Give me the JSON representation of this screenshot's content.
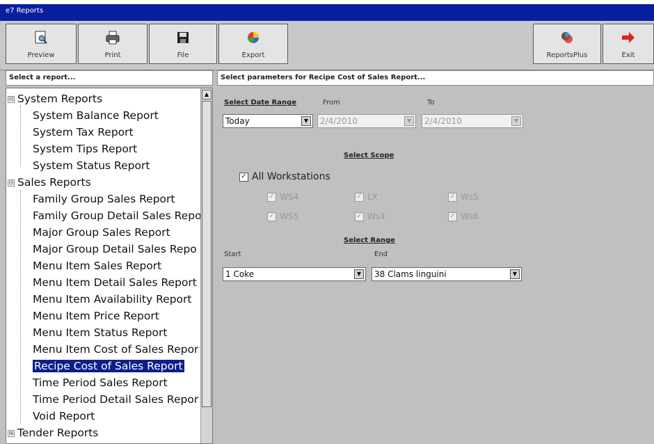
{
  "window": {
    "title": "e7 Reports"
  },
  "toolbar": {
    "preview": {
      "label": "Preview",
      "icon": "preview-icon"
    },
    "print": {
      "label": "Print",
      "icon": "printer-icon"
    },
    "file": {
      "label": "File",
      "icon": "floppy-disk-icon"
    },
    "export": {
      "label": "Export",
      "icon": "export-icon"
    },
    "reportsplus": {
      "label": "ReportsPlus",
      "icon": "reportsplus-icon"
    },
    "exit": {
      "label": "Exit",
      "icon": "exit-arrow-icon"
    }
  },
  "left_header": "Select a report...",
  "right_header": "Select parameters for Recipe Cost of Sales Report...",
  "tree": {
    "system": {
      "label": "System Reports",
      "expander": "⊟",
      "items": [
        "System Balance Report",
        "System Tax Report",
        "System Tips Report",
        "System Status Report"
      ]
    },
    "sales": {
      "label": "Sales Reports",
      "expander": "⊟",
      "items": [
        "Family Group Sales Report",
        "Family Group Detail Sales Repo",
        "Major Group Sales Report",
        "Major Group Detail Sales Repo",
        "Menu Item Sales Report",
        "Menu Item Detail Sales Report",
        "Menu Item Availability Report",
        "Menu Item Price Report",
        "Menu Item Status Report",
        "Menu Item Cost of Sales Repor",
        "Recipe Cost of Sales Report",
        "Time Period Sales Report",
        "Time Period Detail Sales Repor",
        "Void Report"
      ]
    },
    "tender": {
      "label": "Tender Reports",
      "expander": "⊞"
    },
    "selected": "Recipe Cost of Sales Report"
  },
  "params": {
    "date_range_label": "Select Date Range",
    "from_label": "From",
    "to_label": "To",
    "date_range_value": "Today",
    "from_value": "2/4/2010",
    "to_value": "2/4/2010",
    "scope_label": "Select Scope",
    "all_workstations": "All Workstations",
    "workstations": [
      "WS4",
      "LX",
      "WsS",
      "WS5",
      "Ws4",
      "Ws6"
    ],
    "range_label": "Select Range",
    "start_label": "Start",
    "end_label": "End",
    "start_value": "1 Coke",
    "end_value": "38 Clams linguini"
  },
  "colors": {
    "titlebar": "#0a1fa0",
    "selection": "#0a1f8c",
    "panel": "#c0c0c0"
  }
}
